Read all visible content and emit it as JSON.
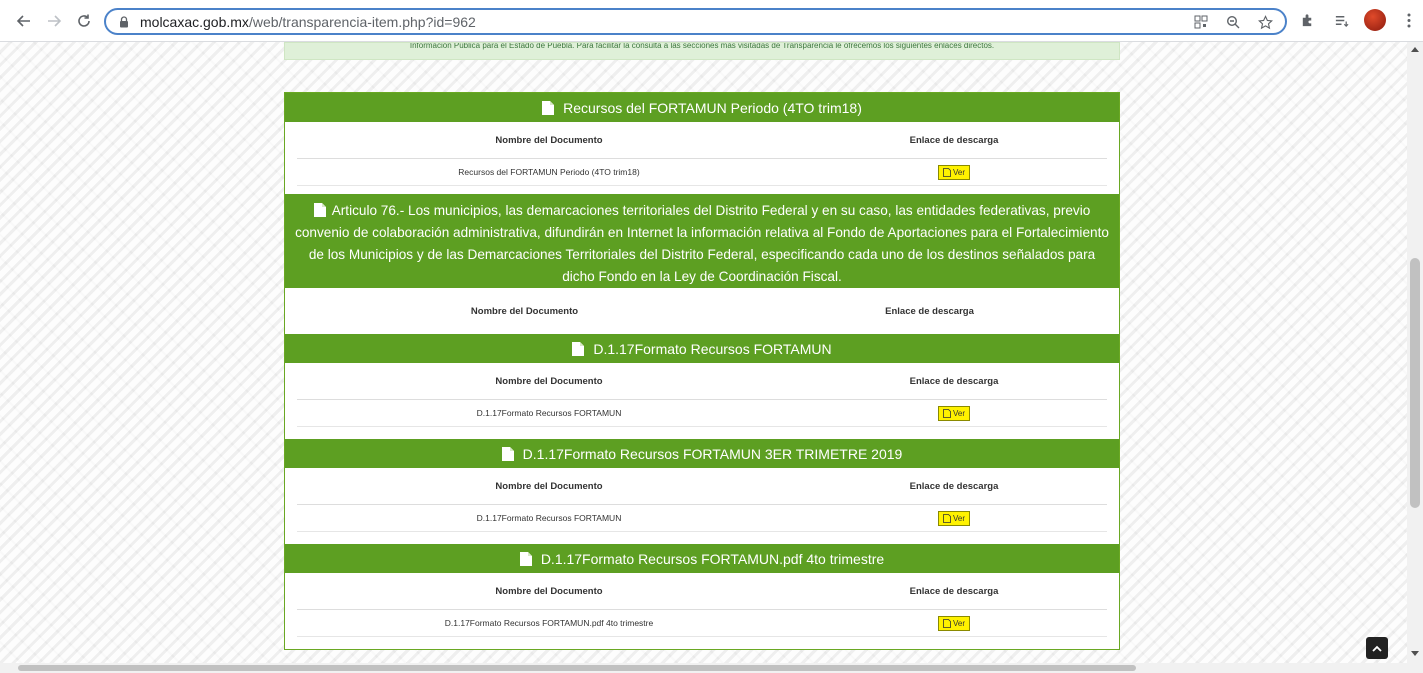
{
  "browser": {
    "url_host": "molcaxac.gob.mx",
    "url_path": "/web/transparencia-item.php?id=962"
  },
  "intro": {
    "text": "Información Pública para el Estado de Puebla. Para facilitar la consulta a las secciones más visitadas de Transparencia le ofrecemos los siguientes enlaces directos."
  },
  "sections": [
    {
      "title": "Recursos del FORTAMUN Periodo (4TO trim18)",
      "col_name": "Nombre del Documento",
      "col_link": "Enlace de descarga",
      "doc_name": "Recursos del FORTAMUN Periodo (4TO trim18)",
      "button": "Ver"
    },
    {
      "title": "Articulo 76.- Los municipios, las demarcaciones territoriales del Distrito Federal y en su caso, las entidades federativas, previo convenio de colaboración administrativa, difundirán en Internet la información relativa al Fondo de Aportaciones para el Fortalecimiento de los Municipios y de las Demarcaciones Territoriales del Distrito Federal, especificando cada uno de los destinos señalados para dicho Fondo en la Ley de Coordinación Fiscal.",
      "col_name": "Nombre del Documento",
      "col_link": "Enlace de descarga"
    },
    {
      "title": "D.1.17Formato Recursos FORTAMUN",
      "col_name": "Nombre del Documento",
      "col_link": "Enlace de descarga",
      "doc_name": "D.1.17Formato Recursos FORTAMUN",
      "button": "Ver"
    },
    {
      "title": "D.1.17Formato Recursos FORTAMUN 3ER TRIMETRE 2019",
      "col_name": "Nombre del Documento",
      "col_link": "Enlace de descarga",
      "doc_name": "D.1.17Formato Recursos FORTAMUN",
      "button": "Ver"
    },
    {
      "title": "D.1.17Formato Recursos FORTAMUN.pdf 4to trimestre",
      "col_name": "Nombre del Documento",
      "col_link": "Enlace de descarga",
      "doc_name": "D.1.17Formato Recursos FORTAMUN.pdf 4to trimestre",
      "button": "Ver"
    }
  ],
  "colors": {
    "header_green": "#5d9f22",
    "button_yellow": "#fff200"
  },
  "icons": {
    "doc": "file-icon",
    "ver": "document-icon",
    "scroll_top": "chevron-up-icon"
  }
}
